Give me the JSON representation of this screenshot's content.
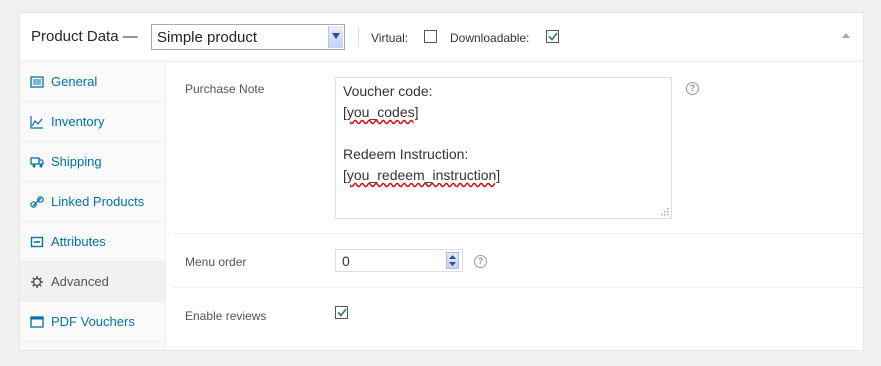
{
  "header": {
    "title": "Product Data —",
    "product_type": "Simple product",
    "virtual_label": "Virtual:",
    "virtual_checked": false,
    "downloadable_label": "Downloadable:",
    "downloadable_checked": true
  },
  "tabs": [
    {
      "label": "General",
      "icon": "grid-icon",
      "active": false
    },
    {
      "label": "Inventory",
      "icon": "chart-line-icon",
      "active": false
    },
    {
      "label": "Shipping",
      "icon": "truck-icon",
      "active": false
    },
    {
      "label": "Linked Products",
      "icon": "link-icon",
      "active": false
    },
    {
      "label": "Attributes",
      "icon": "attribute-icon",
      "active": false
    },
    {
      "label": "Advanced",
      "icon": "gear-icon",
      "active": true
    },
    {
      "label": "PDF Vouchers",
      "icon": "window-icon",
      "active": false
    }
  ],
  "fields": {
    "purchase_note": {
      "label": "Purchase Note",
      "lines": [
        "Voucher code:",
        "[you_codes]",
        "",
        "Redeem Instruction:",
        "[you_redeem_instruction]"
      ]
    },
    "menu_order": {
      "label": "Menu order",
      "value": "0"
    },
    "enable_reviews": {
      "label": "Enable reviews",
      "checked": true
    }
  },
  "colors": {
    "link": "#0073aa",
    "check": "#1e8cbe",
    "active_tab_bg": "#f1f1f1"
  }
}
